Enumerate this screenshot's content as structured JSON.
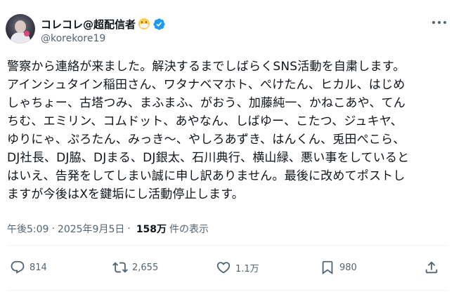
{
  "author": {
    "display_name": "コレコレ@超配信者",
    "handle": "@korekore19",
    "emoji": "mask-face-icon",
    "verified": "verified-badge-icon"
  },
  "post": {
    "lines": [
      "警察から連絡が来ました。解決するまでしばらくSNS活動を自粛します。",
      "アインシュタイン稲田さん、ワタナベマホト、ぺけたん、ヒカル、はじめ",
      "しゃちょー、古塔つみ、まふまふ、がおう、加藤純一、かねこあや、てん",
      "ちむ、エミリン、コムドット、あやなん、しばゆー、こたつ、ジュキヤ、",
      "ゆりにゃ、ぷろたん、みっき～、やしろあずき、はんくん、兎田ぺこら、",
      "DJ社長、DJ脇、DJまる、DJ銀太、石川典行、横山緑、悪い事をしていると",
      "はいえ、告発をしてしまい誠に申し訳ありません。最後に改めてポストし",
      "ますが今後はXを鍵垢にし活動停止します。"
    ]
  },
  "meta": {
    "time": "午後5:09",
    "separator": "·",
    "date": "2025年9月5日",
    "views_count": "158万",
    "views_label": "件の表示"
  },
  "actions": {
    "replies": "814",
    "reposts": "2,655",
    "likes": "1.1万",
    "bookmarks": "980"
  },
  "colors": {
    "text": "#0f1419",
    "secondary": "#536471",
    "verified": "#1d9bf0",
    "divider": "#eff3f4"
  }
}
